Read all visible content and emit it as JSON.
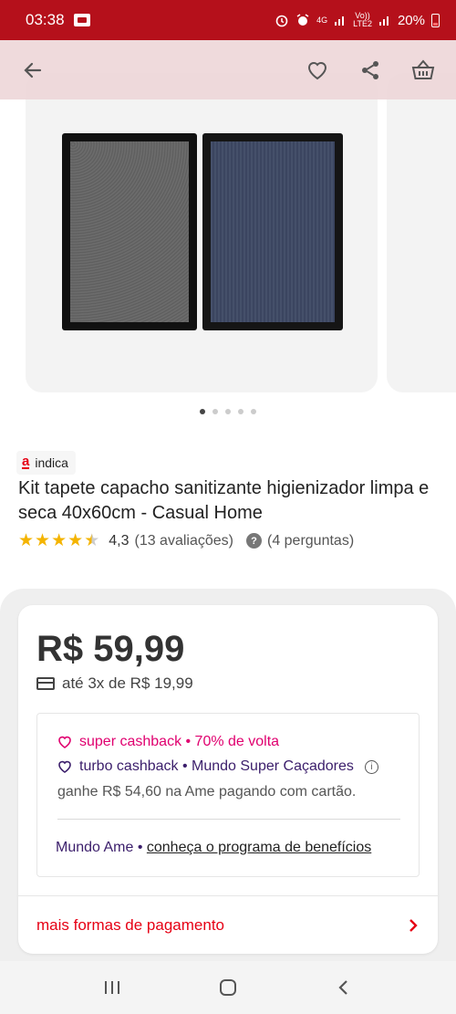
{
  "status_bar": {
    "time": "03:38",
    "network": "4G",
    "volte": "Vo))\nLTE2",
    "battery": "20%"
  },
  "top_bar": {
    "icons": [
      "back-arrow-icon",
      "heart-icon",
      "share-icon",
      "basket-icon"
    ]
  },
  "gallery": {
    "image_count": 5,
    "active_index": 0
  },
  "product": {
    "badge_logo": "a",
    "badge_label": "indica",
    "title": "Kit tapete capacho sanitizante higienizador limpa e seca 40x60cm - Casual Home",
    "rating_value": "4,3",
    "rating_stars": 4.3,
    "reviews": "(13 avaliações)",
    "questions": "(4 perguntas)"
  },
  "pricing": {
    "price": "R$ 59,99",
    "installments": "até 3x de R$ 19,99",
    "super_cashback": "super cashback • 70% de volta",
    "turbo_cashback": "turbo cashback • Mundo Super Caçadores",
    "ame_earn": "ganhe R$ 54,60 na Ame pagando com cartão.",
    "mundo_prefix": "Mundo Ame • ",
    "mundo_link": "conheça o programa de benefícios",
    "more_payment": "mais formas de pagamento"
  },
  "colors": {
    "brand_red": "#e60014",
    "status_bar": "#b5101b",
    "cashback_pink": "#e0006f",
    "turbo_purple": "#3b1e6b",
    "star": "#f4b400"
  }
}
